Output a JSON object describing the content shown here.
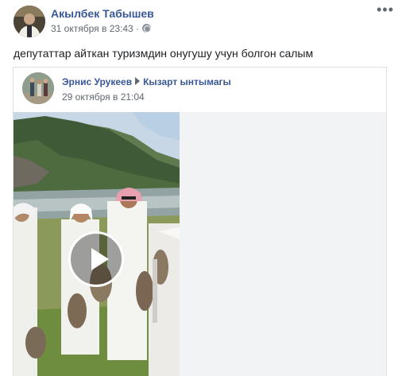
{
  "post": {
    "author": "Акылбек Табышев",
    "timestamp": "31 октября в 23:43 ·",
    "privacy_icon": "globe-icon",
    "more_icon": "more-options-icon",
    "more_label": "•••",
    "message": "депутаттар айткан туризмдин онугушу учун болгон салым"
  },
  "shared_post": {
    "author": "Эрнис Урукеев",
    "group": "Кызарт ынтымагы",
    "timestamp": "29 октября в 21:04",
    "video": {
      "play_icon": "play-icon"
    }
  },
  "colors": {
    "link": "#385898",
    "meta": "#606770",
    "placeholder": "#f2f3f5"
  }
}
